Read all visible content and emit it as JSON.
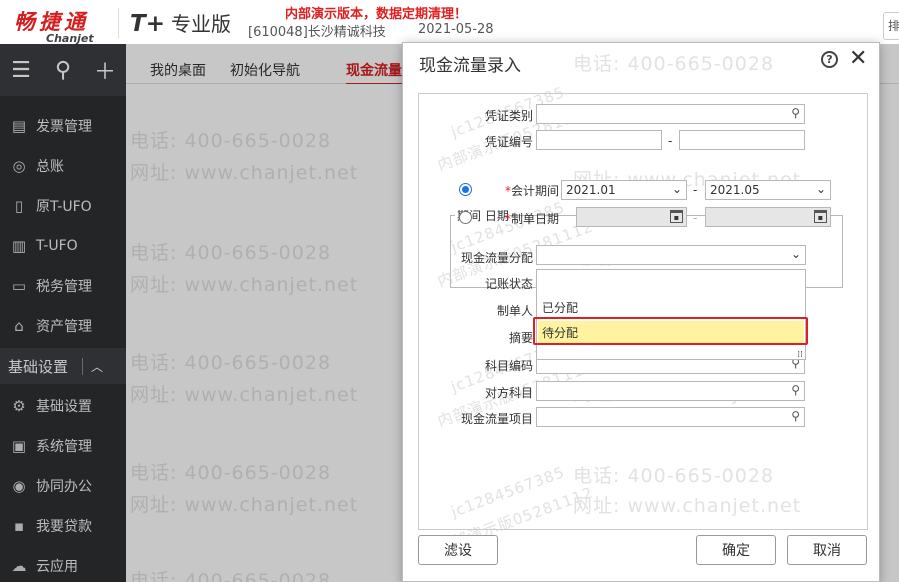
{
  "header": {
    "logo_cn": "畅捷通",
    "logo_en": "Chanjet",
    "product_brand": "T+",
    "product_edition": "专业版",
    "company": "[610048]长沙精诚科技",
    "demo_notice": "内部演示版本，数据定期清理！",
    "date": "2021-05-28",
    "topright_text": "排"
  },
  "sidebar": {
    "items_top": [
      {
        "label": "发票管理",
        "icon": "invoice-icon"
      },
      {
        "label": "总账",
        "icon": "ledger-icon"
      },
      {
        "label": "原T-UFO",
        "icon": "ufo-icon"
      },
      {
        "label": "T-UFO",
        "icon": "report-icon"
      },
      {
        "label": "税务管理",
        "icon": "tax-icon"
      },
      {
        "label": "资产管理",
        "icon": "asset-icon"
      }
    ],
    "group_label": "基础设置",
    "items_bottom": [
      {
        "label": "基础设置",
        "icon": "settings-icon"
      },
      {
        "label": "系统管理",
        "icon": "system-icon"
      },
      {
        "label": "协同办公",
        "icon": "collab-icon"
      },
      {
        "label": "我要贷款",
        "icon": "loan-icon"
      },
      {
        "label": "云应用",
        "icon": "cloud-icon"
      }
    ]
  },
  "tabs": [
    "我的桌面",
    "初始化导航",
    "现金流量"
  ],
  "watermark": {
    "phone": "电话: 400-665-0028",
    "web": "网址: www.chanjet.net",
    "demo_id": "jc1284567385",
    "demo_note": "内部演示版05281112"
  },
  "dialog": {
    "title": "现金流量录入",
    "labels": {
      "voucher_type": "凭证类别",
      "voucher_no": "凭证编号",
      "period_legend": "期间 日期",
      "accounting_period": "会计期间",
      "create_date": "制单日期",
      "cashflow_alloc": "现金流量分配",
      "post_status": "记账状态",
      "creator": "制单人",
      "summary": "摘要",
      "account_code": "科目编码",
      "contra_account": "对方科目",
      "cashflow_item": "现金流量项目"
    },
    "period_from": "2021.01",
    "period_to": "2021.05",
    "dash": "-",
    "dropdown_options": [
      "",
      "已分配",
      "待分配"
    ],
    "buttons": {
      "filter": "滤设",
      "ok": "确定",
      "cancel": "取消"
    }
  }
}
